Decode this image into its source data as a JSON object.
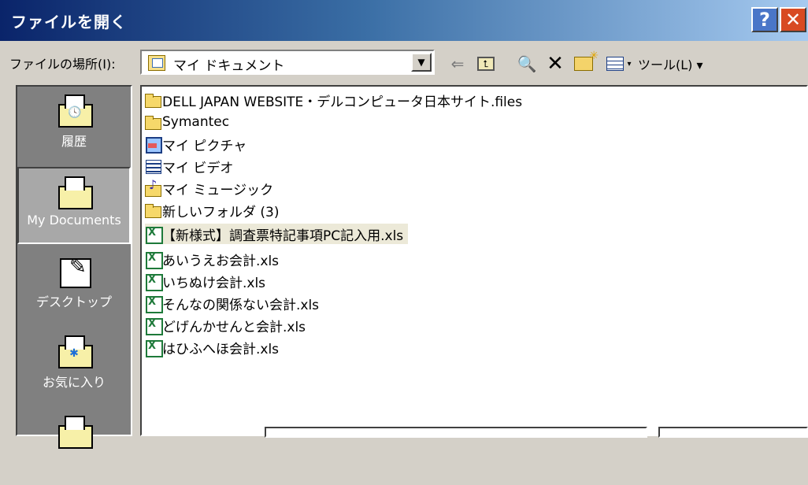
{
  "window": {
    "title": "ファイルを開く",
    "help_label": "?",
    "close_label": "✕"
  },
  "location": {
    "label": "ファイルの場所(I):",
    "current": "マイ ドキュメント",
    "dropdown_arrow": "▼"
  },
  "toolbar": {
    "back_icon": "back-arrow-icon",
    "up_icon": "up-one-level-icon",
    "search_icon": "search-web-icon",
    "delete_icon": "delete-icon",
    "new_folder_icon": "new-folder-icon",
    "views_icon": "views-icon",
    "tools_label": "ツール(L) ▾",
    "views_arrow": "▾"
  },
  "places": [
    {
      "label": "履歴",
      "icon": "history-folder-icon",
      "badge": "🕓",
      "selected": false
    },
    {
      "label": "My Documents",
      "icon": "my-documents-folder-icon",
      "badge": "",
      "selected": true
    },
    {
      "label": "デスクトップ",
      "icon": "desktop-icon",
      "badge": "",
      "selected": false
    },
    {
      "label": "お気に入り",
      "icon": "favorites-folder-icon",
      "badge": "✱",
      "selected": false
    }
  ],
  "files": [
    {
      "name": "DELL JAPAN WEBSITE・デルコンピュータ日本サイト.files",
      "type": "folder"
    },
    {
      "name": "Symantec",
      "type": "folder"
    },
    {
      "name": "マイ ピクチャ",
      "type": "pictures"
    },
    {
      "name": "マイ ビデオ",
      "type": "video"
    },
    {
      "name": "マイ ミュージック",
      "type": "music"
    },
    {
      "name": "新しいフォルダ (3)",
      "type": "folder"
    },
    {
      "name": "【新様式】調査票特記事項PC記入用.xls",
      "type": "xls",
      "selected": true
    },
    {
      "name": "あいうえお会計.xls",
      "type": "xls"
    },
    {
      "name": "いちぬけ会計.xls",
      "type": "xls"
    },
    {
      "name": "そんなの関係ない会計.xls",
      "type": "xls"
    },
    {
      "name": "どげんかせんと会計.xls",
      "type": "xls"
    },
    {
      "name": "はひふへほ会計.xls",
      "type": "xls"
    }
  ],
  "colors": {
    "titlebar_start": "#0a246a",
    "titlebar_end": "#a6caf0",
    "face": "#d4d0c8",
    "places_bg": "#808080",
    "selection": "#ece9d8"
  }
}
